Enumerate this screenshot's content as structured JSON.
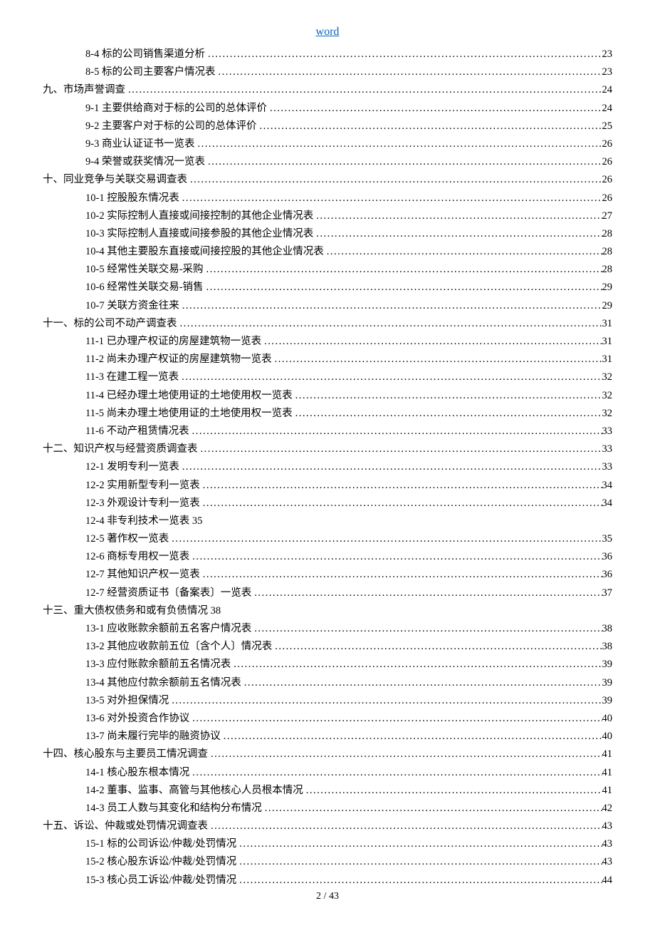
{
  "header": {
    "title_link": "word"
  },
  "footer": {
    "page_current": "2",
    "page_sep": "/",
    "page_total": "43"
  },
  "toc": [
    {
      "level": 2,
      "label": "8-4 标的公司销售渠道分析",
      "page": "23"
    },
    {
      "level": 2,
      "label": "8-5 标的公司主要客户情况表",
      "page": "23"
    },
    {
      "level": 1,
      "label": "九、市场声誉调查",
      "page": "24"
    },
    {
      "level": 2,
      "label": "9-1 主要供给商对于标的公司的总体评价",
      "page": "24"
    },
    {
      "level": 2,
      "label": "9-2 主要客户对于标的公司的总体评价",
      "page": "25"
    },
    {
      "level": 2,
      "label": "9-3 商业认证证书一览表",
      "page": "26"
    },
    {
      "level": 2,
      "label": "9-4 荣誉或获奖情况一览表",
      "page": "26"
    },
    {
      "level": 1,
      "label": "十、同业竞争与关联交易调查表",
      "page": "26"
    },
    {
      "level": 2,
      "label": "10-1 控股股东情况表",
      "page": "26"
    },
    {
      "level": 2,
      "label": "10-2 实际控制人直接或间接控制的其他企业情况表 ",
      "page": "27"
    },
    {
      "level": 2,
      "label": "10-3 实际控制人直接或间接参股的其他企业情况表 ",
      "page": "28"
    },
    {
      "level": 2,
      "label": "10-4 其他主要股东直接或间接控股的其他企业情况表",
      "page": "28"
    },
    {
      "level": 2,
      "label": "10-5 经常性关联交易-采购",
      "page": "28"
    },
    {
      "level": 2,
      "label": "10-6 经常性关联交易-销售",
      "page": "29"
    },
    {
      "level": 2,
      "label": "10-7 关联方资金往来",
      "page": "29"
    },
    {
      "level": 1,
      "label": "十一、标的公司不动产调查表",
      "page": "31"
    },
    {
      "level": 2,
      "label": "11-1 已办理产权证的房屋建筑物一览表",
      "page": "31"
    },
    {
      "level": 2,
      "label": "11-2 尚未办理产权证的房屋建筑物一览表",
      "page": "31"
    },
    {
      "level": 2,
      "label": "11-3 在建工程一览表",
      "page": "32"
    },
    {
      "level": 2,
      "label": "11-4 已经办理土地使用证的土地使用权一览表",
      "page": "32"
    },
    {
      "level": 2,
      "label": "11-5 尚未办理土地使用证的土地使用权一览表",
      "page": "32"
    },
    {
      "level": 2,
      "label": "11-6 不动产租赁情况表",
      "page": "33"
    },
    {
      "level": 1,
      "label": "十二、知识产权与经营资质调查表",
      "page": "33"
    },
    {
      "level": 2,
      "label": "12-1 发明专利一览表",
      "page": "33"
    },
    {
      "level": 2,
      "label": "12-2 实用新型专利一览表",
      "page": "34"
    },
    {
      "level": 2,
      "label": "12-3 外观设计专利一览表",
      "page": "34"
    },
    {
      "level": 2,
      "label": "12-4 非专利技术一览表 35",
      "page": ""
    },
    {
      "level": 2,
      "label": "12-5 著作权一览表",
      "page": "35"
    },
    {
      "level": 2,
      "label": "12-6 商标专用权一览表",
      "page": "36"
    },
    {
      "level": 2,
      "label": "12-7 其他知识产权一览表",
      "page": "36"
    },
    {
      "level": 2,
      "label": "12-7 经营资质证书〔备案表〕一览表",
      "page": "37"
    },
    {
      "level": 1,
      "label": "十三、重大债权债务和或有负债情况 38",
      "page": ""
    },
    {
      "level": 2,
      "label": "13-1 应收账款余额前五名客户情况表",
      "page": "38"
    },
    {
      "level": 2,
      "label": "13-2 其他应收款前五位〔含个人〕情况表",
      "page": "38"
    },
    {
      "level": 2,
      "label": "13-3 应付账款余额前五名情况表",
      "page": "39"
    },
    {
      "level": 2,
      "label": "13-4 其他应付款余额前五名情况表",
      "page": "39"
    },
    {
      "level": 2,
      "label": "13-5 对外担保情况",
      "page": "39"
    },
    {
      "level": 2,
      "label": "13-6 对外投资合作协议",
      "page": "40"
    },
    {
      "level": 2,
      "label": "13-7 尚未履行完毕的融资协议",
      "page": "40"
    },
    {
      "level": 1,
      "label": "十四、核心股东与主要员工情况调查",
      "page": "41"
    },
    {
      "level": 2,
      "label": "14-1 核心股东根本情况",
      "page": "41"
    },
    {
      "level": 2,
      "label": "14-2 董事、监事、高管与其他核心人员根本情况",
      "page": "41"
    },
    {
      "level": 2,
      "label": "14-3 员工人数与其变化和结构分布情况",
      "page": "42"
    },
    {
      "level": 1,
      "label": "十五、诉讼、仲裁或处罚情况调查表",
      "page": "43"
    },
    {
      "level": 2,
      "label": "15-1 标的公司诉讼/仲裁/处罚情况",
      "page": "43"
    },
    {
      "level": 2,
      "label": "15-2 核心股东诉讼/仲裁/处罚情况",
      "page": "43"
    },
    {
      "level": 2,
      "label": "15-3 核心员工诉讼/仲裁/处罚情况",
      "page": "44"
    }
  ]
}
